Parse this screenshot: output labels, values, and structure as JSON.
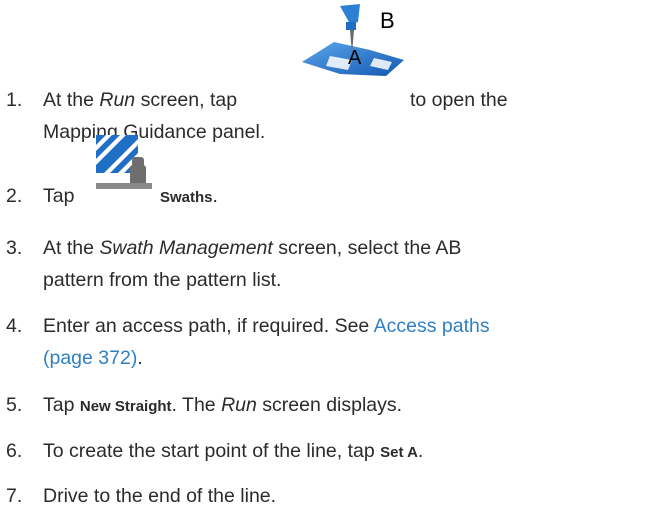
{
  "steps": [
    {
      "num": "1.",
      "line1_a": "At the ",
      "line1_em": "Run",
      "line1_b": " screen, tap",
      "line1_c": "to open the",
      "line2": "Mapping Guidance panel.",
      "icon": "ab-pin-icon",
      "icon_label_a": "A",
      "icon_label_b": "B"
    },
    {
      "num": "2.",
      "a": "Tap",
      "ui": "Swaths",
      "b": ".",
      "icon": "swaths-icon"
    },
    {
      "num": "3.",
      "line1_a": "At the ",
      "line1_em": "Swath Management",
      "line1_b": " screen, select the AB",
      "line2": "pattern from the pattern list."
    },
    {
      "num": "4.",
      "line1_a": "Enter an access path, if required. See ",
      "link_a": "Access paths",
      "link_b": "(page 372)",
      "line2_b": "."
    },
    {
      "num": "5.",
      "a": "Tap ",
      "ui": "New Straight",
      "b": ". The ",
      "em": "Run",
      "c": " screen displays."
    },
    {
      "num": "6.",
      "a": "To create the start point of the line, tap ",
      "ui": "Set A",
      "b": "."
    },
    {
      "num": "7.",
      "a": "Drive to the end of the line."
    }
  ],
  "colors": {
    "text": "#2b2b2b",
    "link": "#2e7fc3",
    "icon_blue": "#1f6fc5"
  }
}
